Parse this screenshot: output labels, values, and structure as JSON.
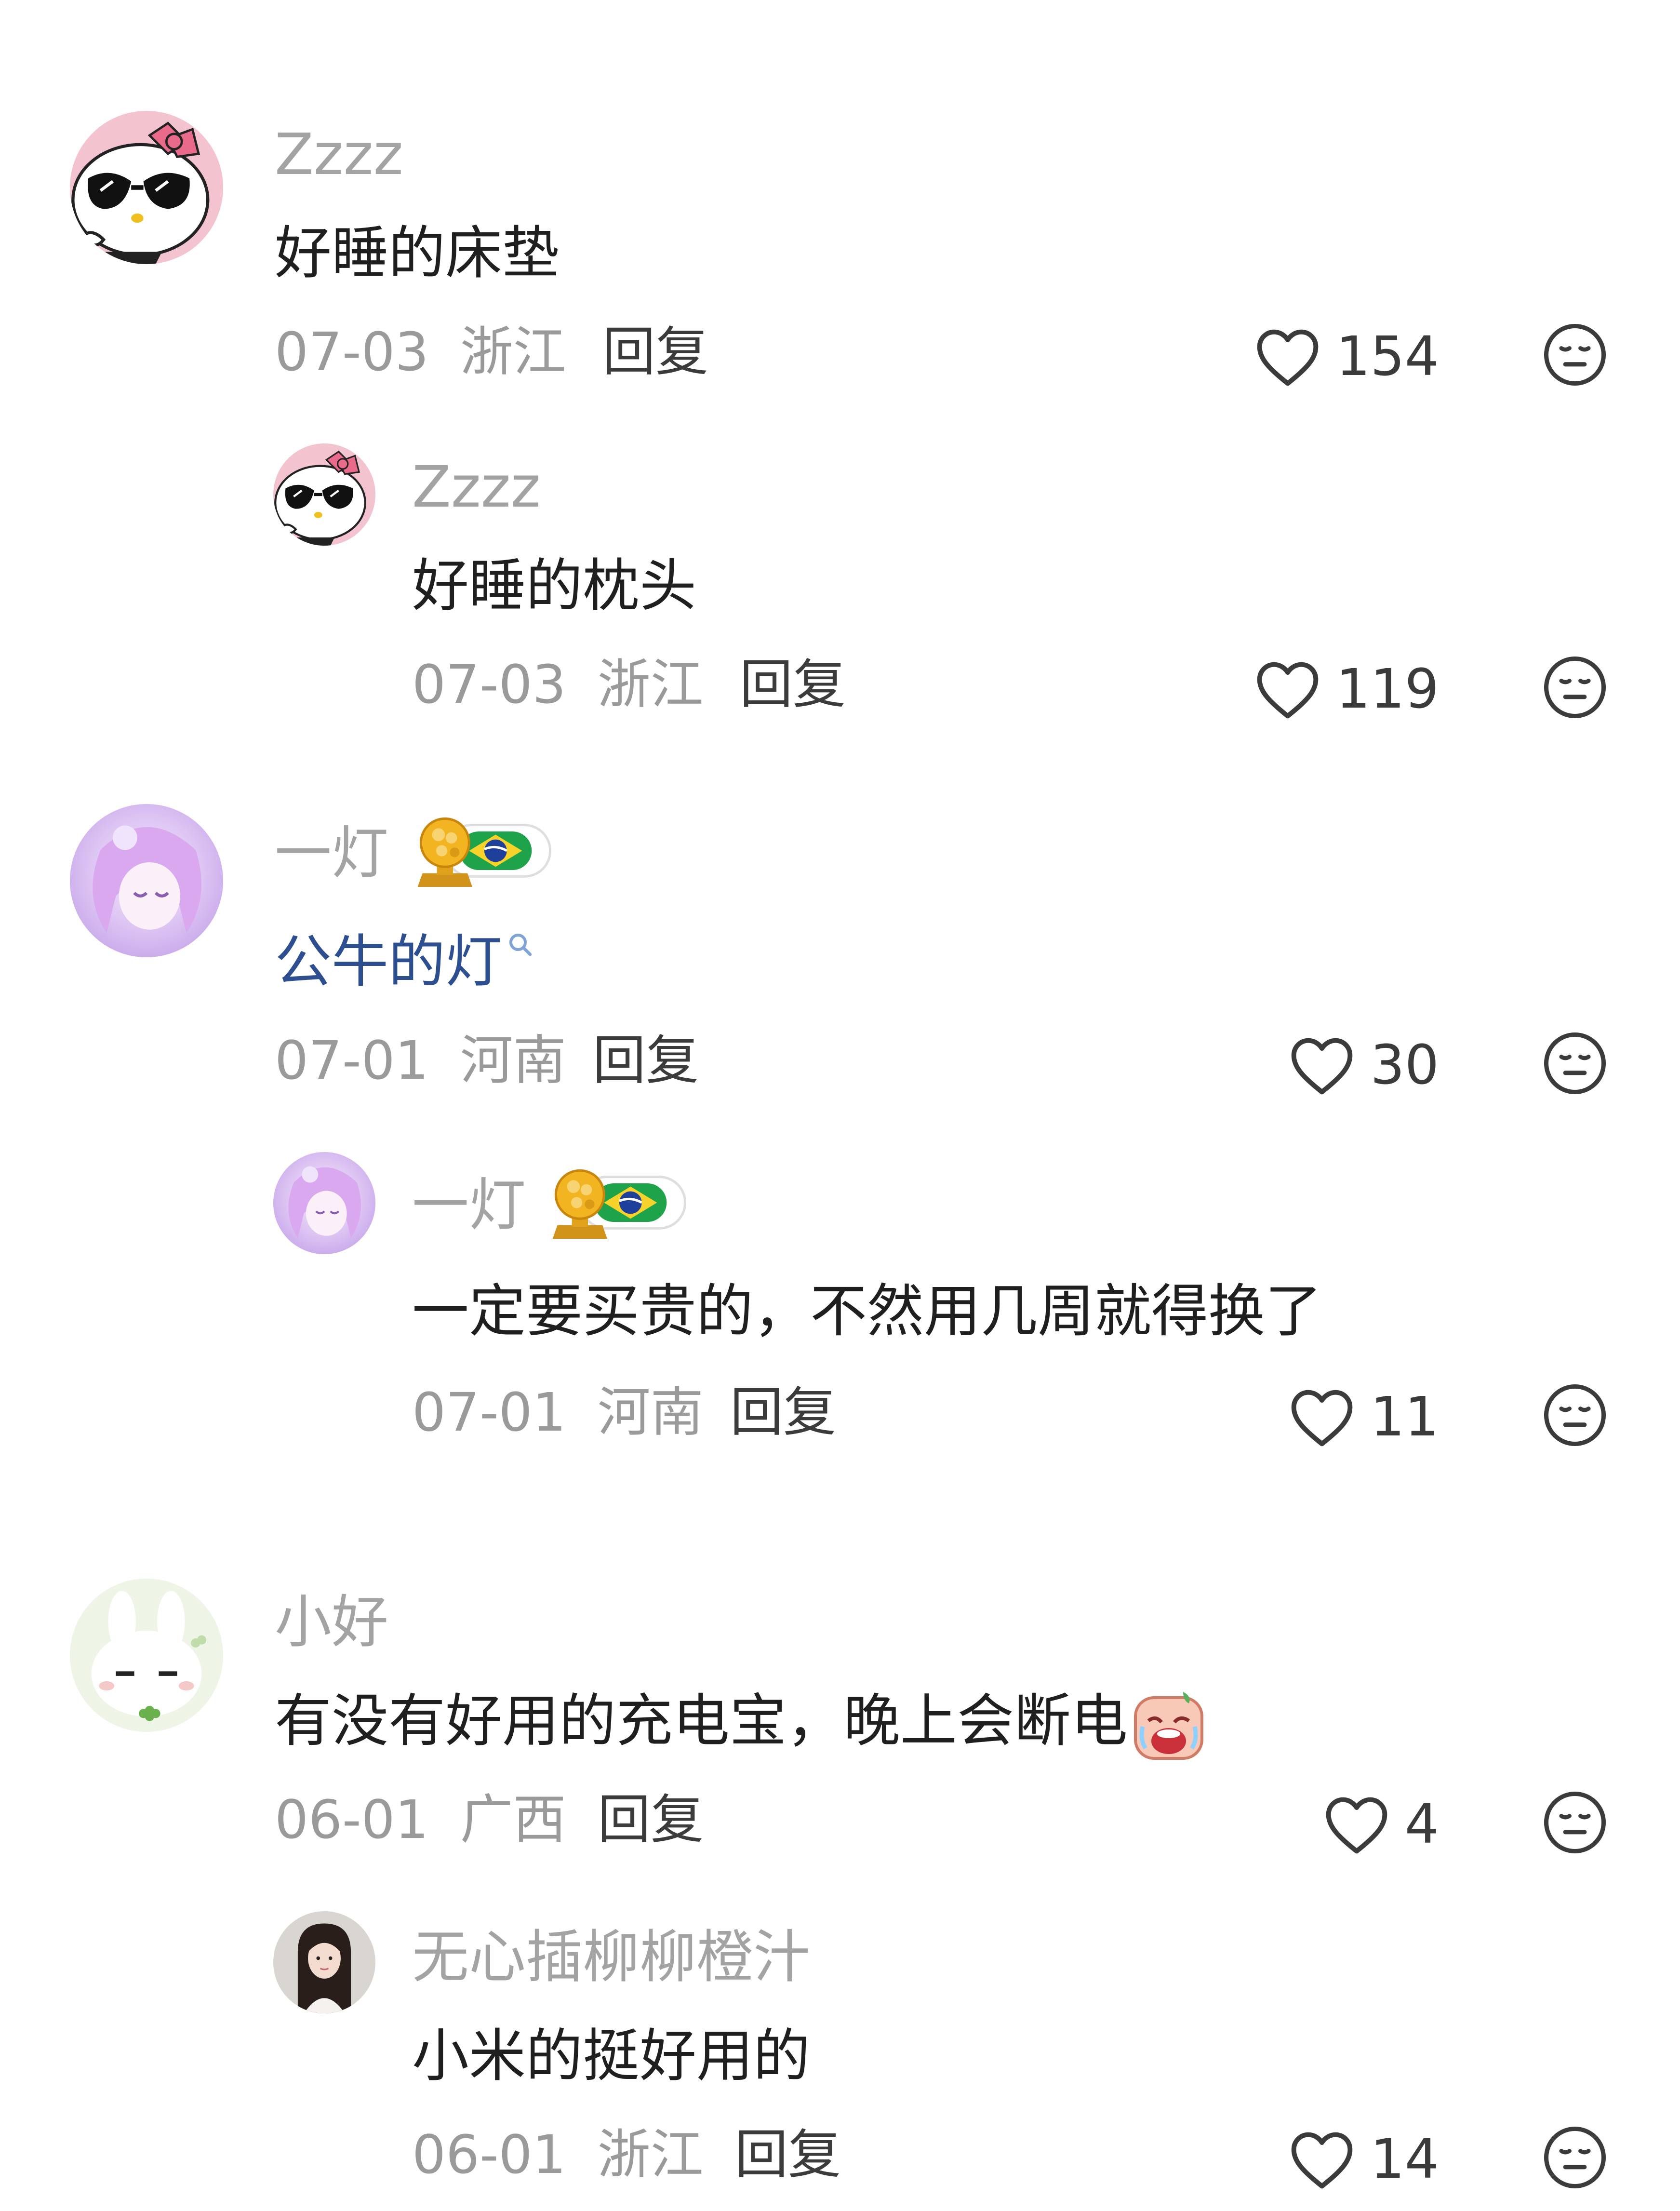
{
  "comments": [
    {
      "user": "Zzzz",
      "text": "好睡的床垫",
      "date": "07-03",
      "location": "浙江",
      "reply_label": "回复",
      "likes": "154",
      "replies": [
        {
          "user": "Zzzz",
          "text": "好睡的枕头",
          "date": "07-03",
          "location": "浙江",
          "reply_label": "回复",
          "likes": "119"
        }
      ]
    },
    {
      "user": "一灯",
      "text": "公牛的灯",
      "date": "07-01",
      "location": "河南",
      "reply_label": "回复",
      "likes": "30",
      "replies": [
        {
          "user": "一灯",
          "text": "一定要买贵的，不然用几周就得换了",
          "date": "07-01",
          "location": "河南",
          "reply_label": "回复",
          "likes": "11"
        }
      ]
    },
    {
      "user": "小好",
      "text": "有没有好用的充电宝，晚上会断电",
      "date": "06-01",
      "location": "广西",
      "reply_label": "回复",
      "likes": "4",
      "replies": [
        {
          "user": "无心插柳柳橙汁",
          "text": "小米的挺好用的",
          "date": "06-01",
          "location": "浙江",
          "reply_label": "回复",
          "likes": "14"
        }
      ]
    }
  ],
  "colors": {
    "username": "#a3a3a3",
    "body_text": "#1f1f1f",
    "link_text": "#2e4f8f",
    "meta": "#9a9a9a"
  }
}
